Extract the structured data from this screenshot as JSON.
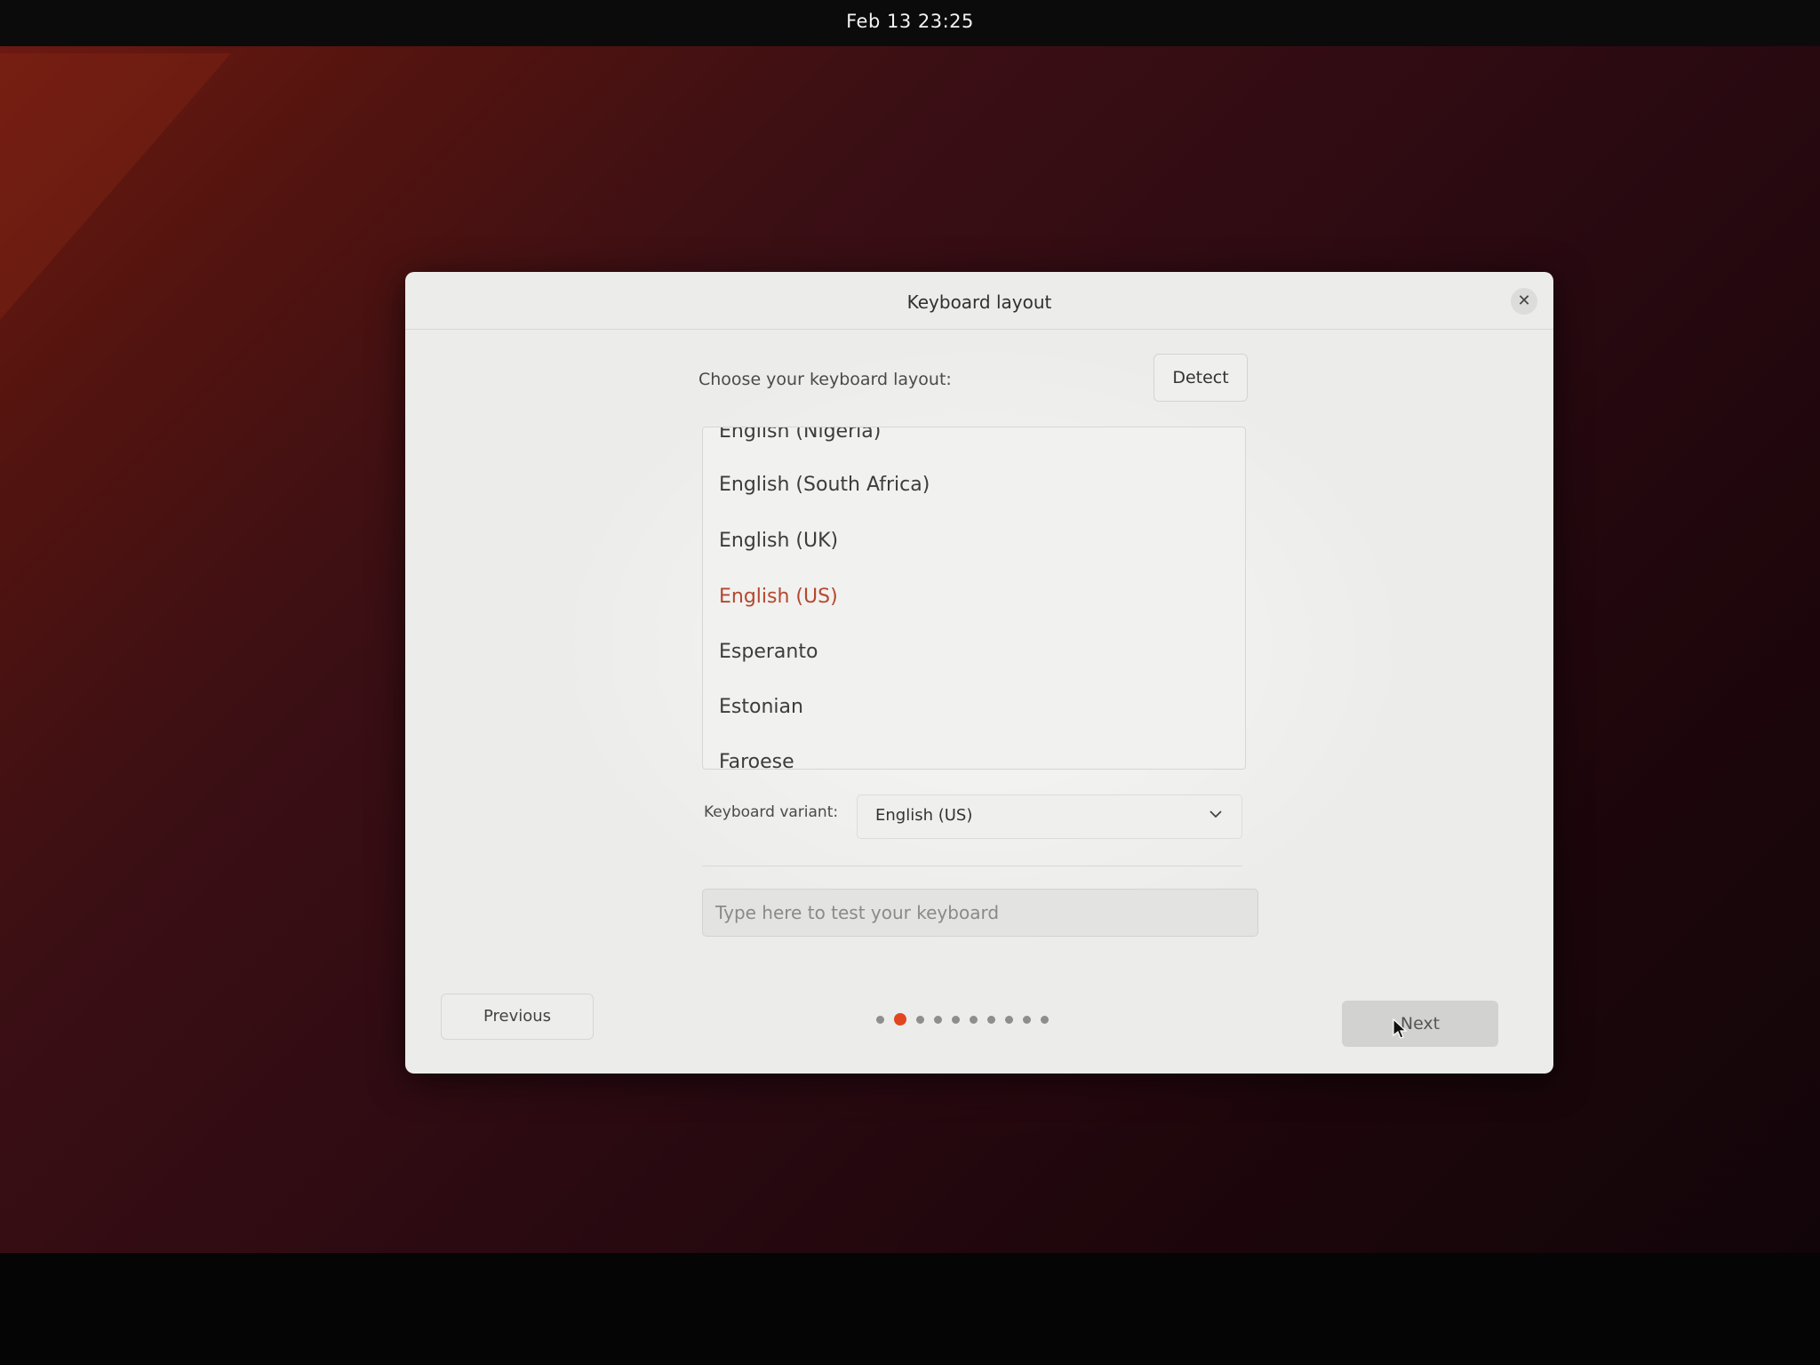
{
  "topbar": {
    "clock": "Feb 13  23:25"
  },
  "dialog": {
    "title": "Keyboard layout",
    "close_icon": "close-icon",
    "layout_label": "Choose your keyboard layout:",
    "detect_label": "Detect",
    "layouts": [
      {
        "label": "English (Nigeria)",
        "selected": false
      },
      {
        "label": "English (South Africa)",
        "selected": false
      },
      {
        "label": "English (UK)",
        "selected": false
      },
      {
        "label": "English (US)",
        "selected": true
      },
      {
        "label": "Esperanto",
        "selected": false
      },
      {
        "label": "Estonian",
        "selected": false
      },
      {
        "label": "Faroese",
        "selected": false
      }
    ],
    "variant_label": "Keyboard variant:",
    "variant_value": "English (US)",
    "test_placeholder": "Type here to test your keyboard",
    "previous_label": "Previous",
    "next_label": "Next",
    "progress": {
      "total_steps": 10,
      "current_step": 2
    }
  },
  "colors": {
    "selected_text": "#b5472f",
    "active_dot": "#e2461f",
    "dialog_bg": "#ececea"
  }
}
